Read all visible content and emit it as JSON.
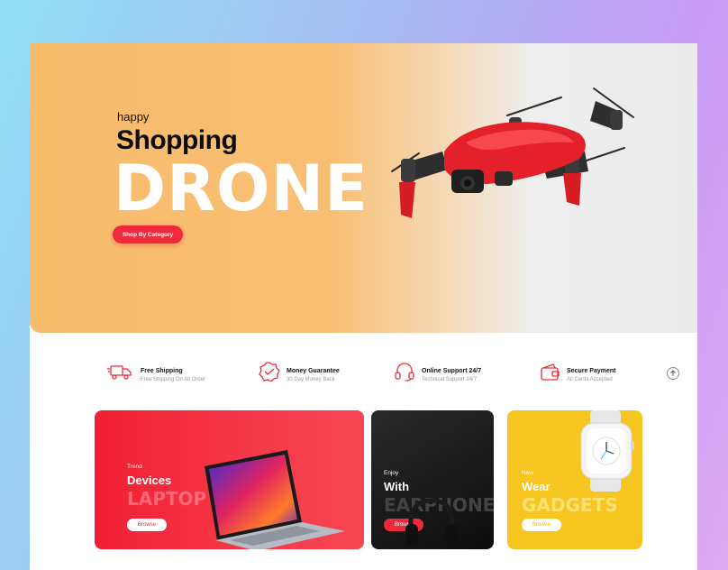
{
  "hero": {
    "small": "happy",
    "title": "Shopping",
    "big": "DRONE",
    "button": "Shop By Category"
  },
  "features": [
    {
      "title": "Free Shipping",
      "sub": "Free Shipping On All Order",
      "icon": "truck-icon"
    },
    {
      "title": "Money Guarantee",
      "sub": "30 Day Money Back",
      "icon": "badge-check-icon"
    },
    {
      "title": "Online Support 24/7",
      "sub": "Technical Support 24/7",
      "icon": "headset-icon"
    },
    {
      "title": "Secure Payment",
      "sub": "All Cards Accepted",
      "icon": "wallet-icon"
    }
  ],
  "cards": [
    {
      "eyebrow": "Trend",
      "title": "Devices",
      "big": "LAPTOP",
      "button": "Browse"
    },
    {
      "eyebrow": "Enjoy",
      "title": "With",
      "big": "EARPHONE",
      "button": "Browse"
    },
    {
      "eyebrow": "New",
      "title": "Wear",
      "big": "GADGETS",
      "button": "Browse"
    }
  ],
  "colors": {
    "accent": "#ef2b3b",
    "hero_orange": "#f8bf73",
    "card_red": "#f11f33",
    "card_dark": "#111111",
    "card_yellow": "#f7c51f"
  }
}
